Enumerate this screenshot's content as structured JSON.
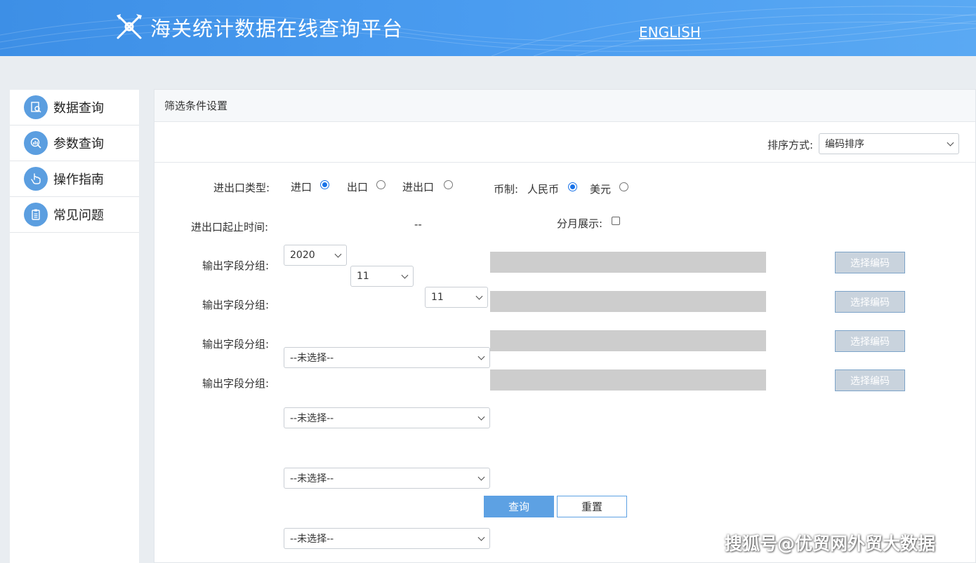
{
  "header": {
    "title": "海关统计数据在线查询平台",
    "lang_link": "ENGLISH"
  },
  "colors": {
    "header": "#4a9cf0",
    "accent": "#5da1e3"
  },
  "sidebar": {
    "items": [
      {
        "label": "数据查询",
        "icon": "data-search-icon"
      },
      {
        "label": "参数查询",
        "icon": "param-chart-icon"
      },
      {
        "label": "操作指南",
        "icon": "hand-pointer-icon"
      },
      {
        "label": "常见问题",
        "icon": "clipboard-icon"
      }
    ]
  },
  "panel": {
    "title": "筛选条件设置",
    "sort_label": "排序方式:",
    "sort_value": "编码排序",
    "trade_type": {
      "label": "进出口类型:",
      "options": [
        {
          "label": "进口",
          "selected": true
        },
        {
          "label": "出口",
          "selected": false
        },
        {
          "label": "进出口",
          "selected": false
        }
      ]
    },
    "currency": {
      "label": "币制:",
      "options": [
        {
          "label": "人民币",
          "selected": true
        },
        {
          "label": "美元",
          "selected": false
        }
      ]
    },
    "period": {
      "label": "进出口起止时间:",
      "year": "2020",
      "month_start": "11",
      "separator": "--",
      "month_end": "11"
    },
    "monthly": {
      "label": "分月展示:",
      "checked": false
    },
    "groups": [
      {
        "label": "输出字段分组:",
        "value": "--未选择--",
        "button": "选择编码"
      },
      {
        "label": "输出字段分组:",
        "value": "--未选择--",
        "button": "选择编码"
      },
      {
        "label": "输出字段分组:",
        "value": "--未选择--",
        "button": "选择编码"
      },
      {
        "label": "输出字段分组:",
        "value": "--未选择--",
        "button": "选择编码"
      }
    ],
    "query_button": "查询",
    "reset_button": "重置"
  },
  "watermark": "搜狐号@优贸网外贸大数据"
}
